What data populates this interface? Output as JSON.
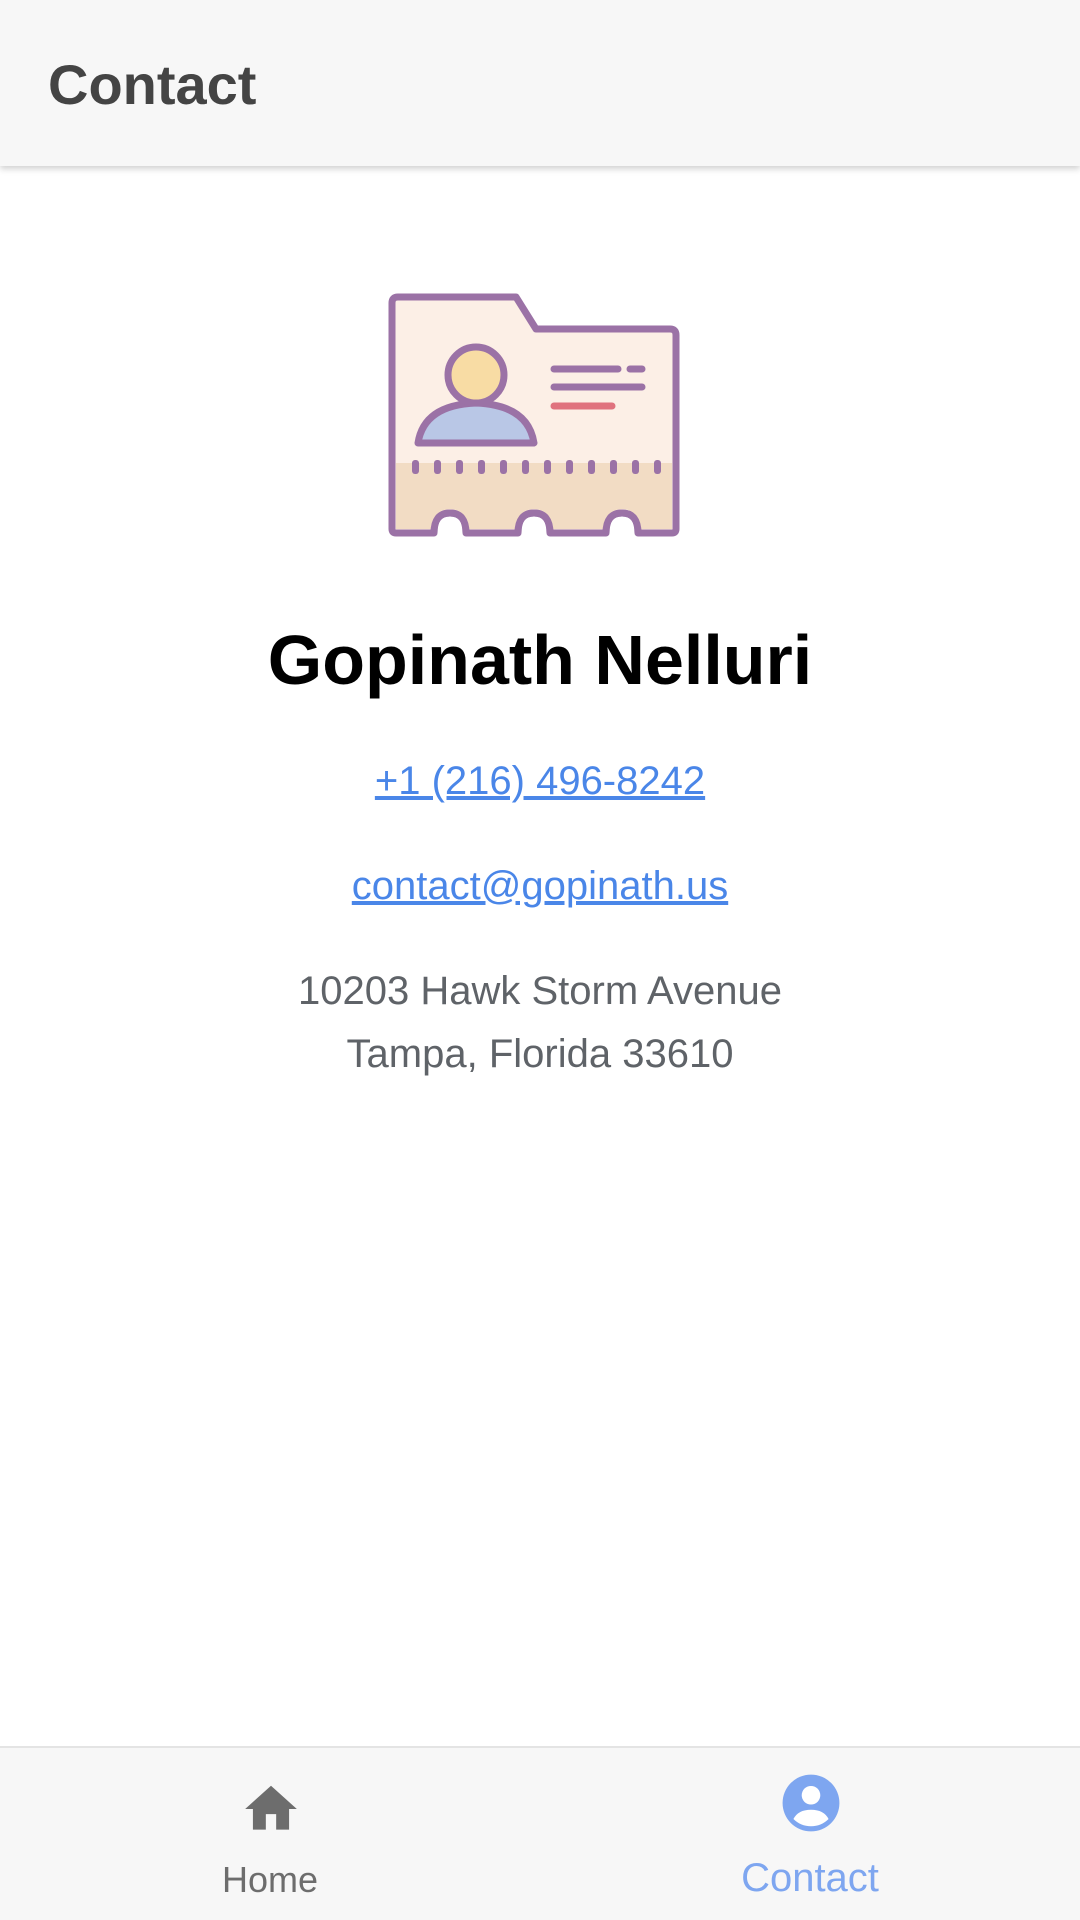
{
  "header": {
    "title": "Contact"
  },
  "profile": {
    "icon": "contact-card-icon",
    "name": "Gopinath Nelluri",
    "phone": "+1 (216) 496-8242",
    "email": "contact@gopinath.us",
    "address_line1": "10203 Hawk Storm Avenue",
    "address_line2": "Tampa, Florida 33610"
  },
  "bottom_nav": {
    "items": [
      {
        "label": "Home",
        "icon": "home-icon",
        "active": false
      },
      {
        "label": "Contact",
        "icon": "account-circle-icon",
        "active": true
      }
    ]
  },
  "colors": {
    "link": "#4a86e8",
    "active_tab": "#7ea6f0",
    "inactive_tab": "#6d6d6d",
    "bar_background": "#f7f7f7"
  }
}
